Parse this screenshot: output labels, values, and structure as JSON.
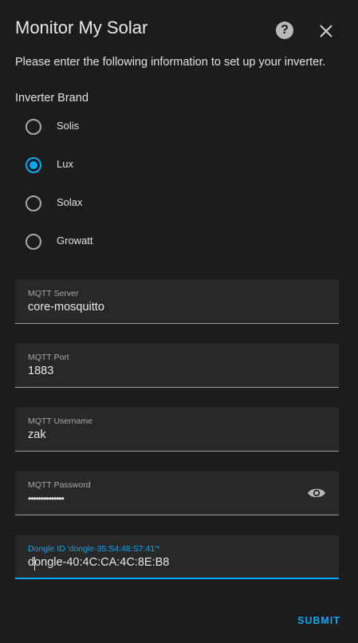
{
  "dialog": {
    "title": "Monitor My Solar",
    "description": "Please enter the following information to set up your inverter."
  },
  "inverter": {
    "group_label": "Inverter Brand",
    "options": [
      {
        "label": "Solis",
        "checked": false
      },
      {
        "label": "Lux",
        "checked": true
      },
      {
        "label": "Solax",
        "checked": false
      },
      {
        "label": "Growatt",
        "checked": false
      }
    ]
  },
  "fields": {
    "mqtt_server": {
      "label": "MQTT Server",
      "value": "core-mosquitto"
    },
    "mqtt_port": {
      "label": "MQTT Port",
      "value": "1883"
    },
    "mqtt_username": {
      "label": "MQTT Username",
      "value": "zak"
    },
    "mqtt_password": {
      "label": "MQTT Password",
      "value": "••••••••••••••"
    },
    "dongle_id": {
      "label": "Dongle ID 'dongle-35:S4:48:S7:41'*",
      "value": "dongle-40:4C:CA:4C:8E:B8"
    }
  },
  "actions": {
    "submit_label": "SUBMIT"
  },
  "colors": {
    "accent": "#03a9f4",
    "background": "#1c1c1c",
    "field_bg": "#282828"
  },
  "icons": {
    "help": "help-circle-icon",
    "close": "close-icon",
    "visibility": "eye-icon"
  }
}
